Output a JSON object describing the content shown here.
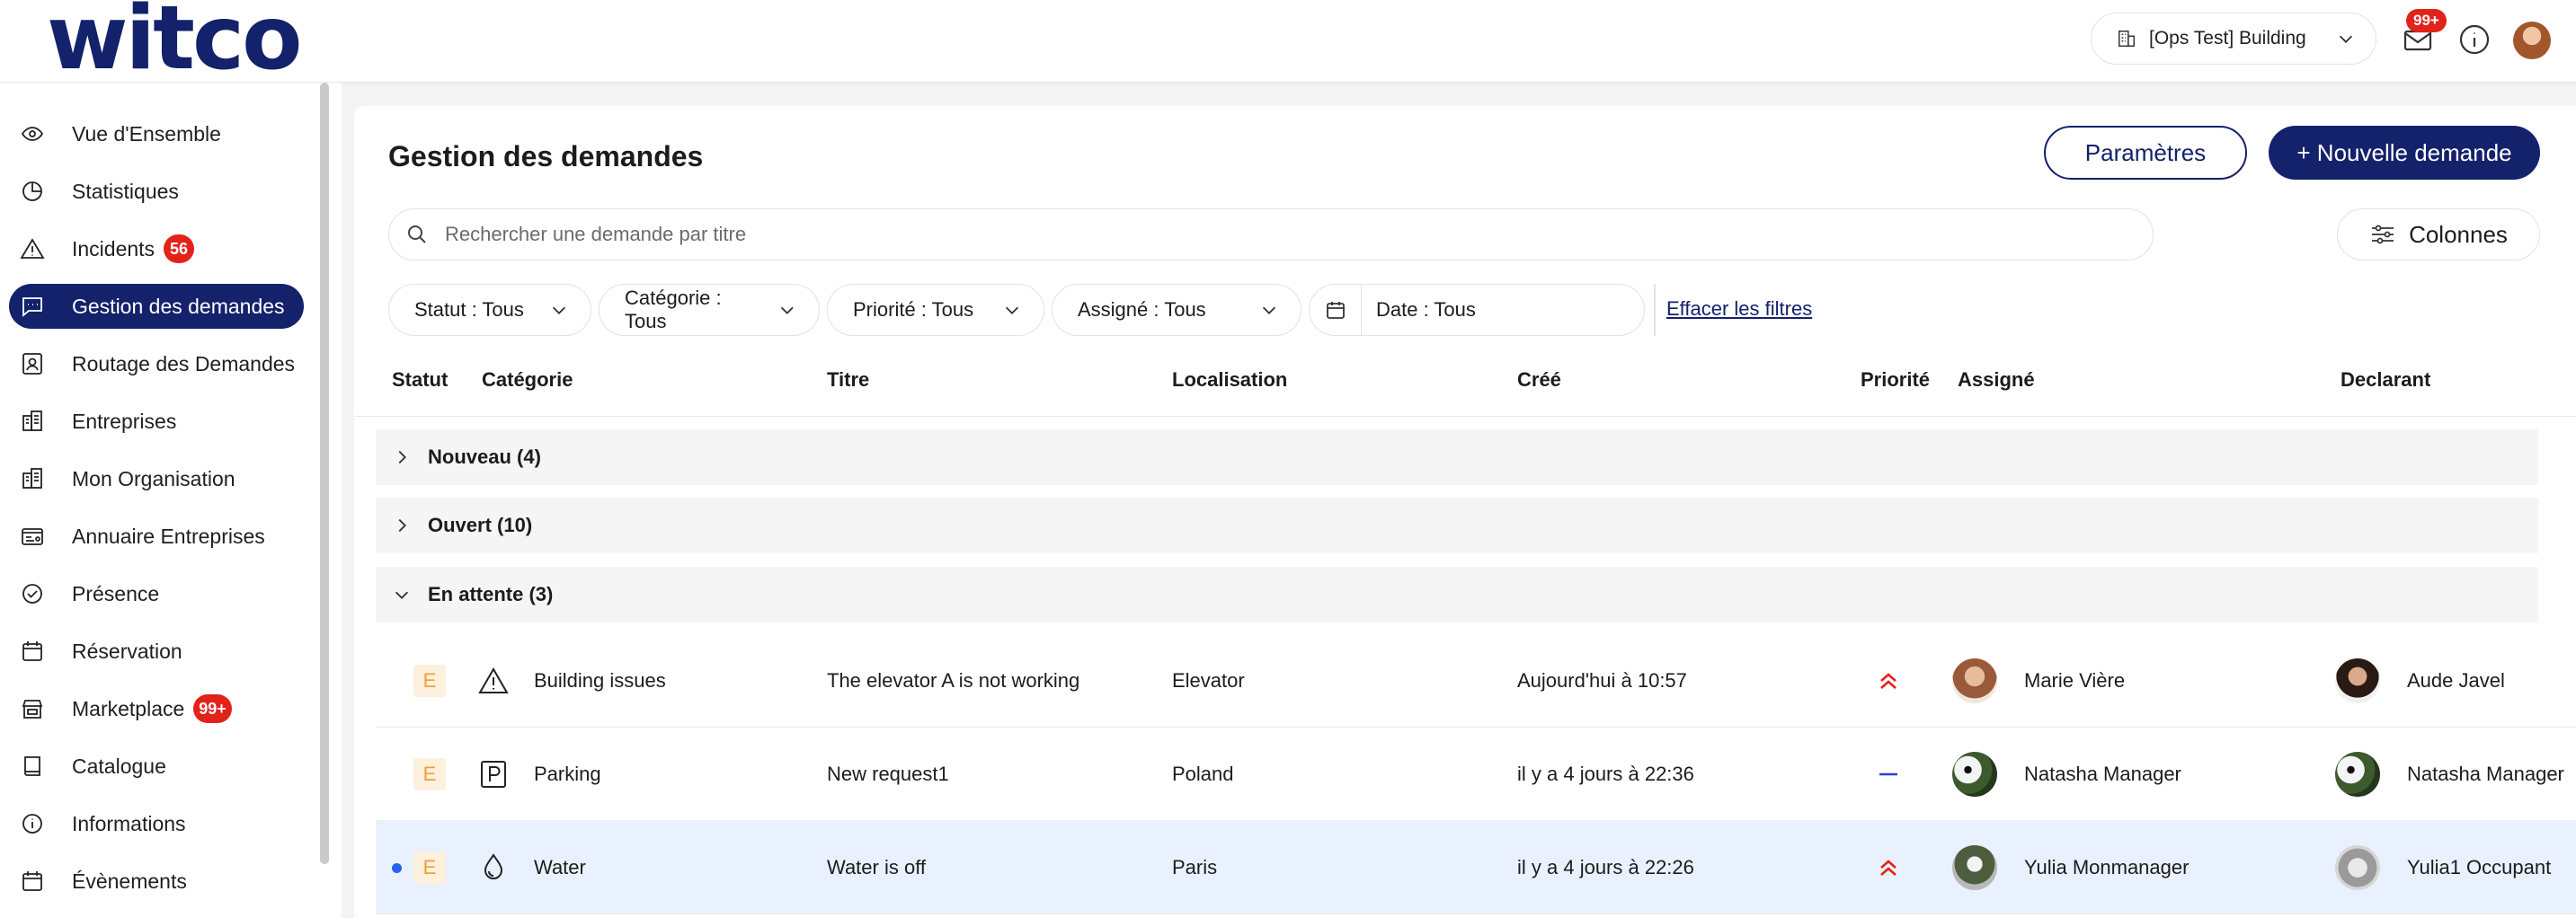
{
  "app": {
    "logo": "witco"
  },
  "topbar": {
    "building": "[Ops Test] Building",
    "mail_badge": "99+"
  },
  "sidebar": {
    "items": [
      {
        "label": "Vue d'Ensemble",
        "icon": "eye-icon"
      },
      {
        "label": "Statistiques",
        "icon": "pie-chart-icon"
      },
      {
        "label": "Incidents",
        "icon": "warning-icon",
        "badge": "56"
      },
      {
        "label": "Gestion des demandes",
        "icon": "chat-icon",
        "active": true
      },
      {
        "label": "Routage des Demandes",
        "icon": "contact-card-icon"
      },
      {
        "label": "Entreprises",
        "icon": "buildings-icon"
      },
      {
        "label": "Mon Organisation",
        "icon": "buildings-icon"
      },
      {
        "label": "Annuaire Entreprises",
        "icon": "directory-icon"
      },
      {
        "label": "Présence",
        "icon": "check-circle-icon"
      },
      {
        "label": "Réservation",
        "icon": "calendar-icon"
      },
      {
        "label": "Marketplace",
        "icon": "store-icon",
        "badge": "99+"
      },
      {
        "label": "Catalogue",
        "icon": "book-icon"
      },
      {
        "label": "Informations",
        "icon": "info-icon"
      },
      {
        "label": "Évènements",
        "icon": "calendar-icon"
      }
    ]
  },
  "main": {
    "title": "Gestion des demandes",
    "settings_label": "Paramètres",
    "new_label": "+ Nouvelle demande",
    "search_placeholder": "Rechercher une demande par titre",
    "columns_label": "Colonnes",
    "filters": {
      "status": "Statut : Tous",
      "category": "Catégorie : Tous",
      "priority": "Priorité : Tous",
      "assignee": "Assigné : Tous",
      "date": "Date : Tous",
      "clear": "Effacer les filtres"
    },
    "columns": [
      "Statut",
      "Catégorie",
      "Titre",
      "Localisation",
      "Créé",
      "Priorité",
      "Assigné",
      "Declarant"
    ],
    "groups": [
      {
        "label": "Nouveau (4)",
        "expanded": false
      },
      {
        "label": "Ouvert (10)",
        "expanded": false
      },
      {
        "label": "En attente (3)",
        "expanded": true
      }
    ],
    "rows": [
      {
        "status": "E",
        "category": "Building issues",
        "category_icon": "warning-icon",
        "title": "The elevator A is not working",
        "location": "Elevator",
        "created": "Aujourd'hui à 10:57",
        "priority": "high",
        "assignee": "Marie Vière",
        "declarant": "Aude Javel"
      },
      {
        "status": "E",
        "category": "Parking",
        "category_icon": "parking-icon",
        "title": "New request1",
        "location": "Poland",
        "created": "il y a 4 jours à 22:36",
        "priority": "medium",
        "assignee": "Natasha Manager",
        "declarant": "Natasha Manager"
      },
      {
        "status": "E",
        "category": "Water",
        "category_icon": "water-drop-icon",
        "title": "Water is off",
        "location": "Paris",
        "created": "il y a 4 jours à 22:26",
        "priority": "high",
        "assignee": "Yulia Monmanager",
        "declarant": "Yulia1 Occupant",
        "unread": true
      }
    ]
  },
  "colors": {
    "brand": "#14216b",
    "badge": "#e2231a",
    "priority_high": "#e2231a",
    "priority_medium": "#2b3bd8",
    "selected_row": "#eaf1fe"
  }
}
